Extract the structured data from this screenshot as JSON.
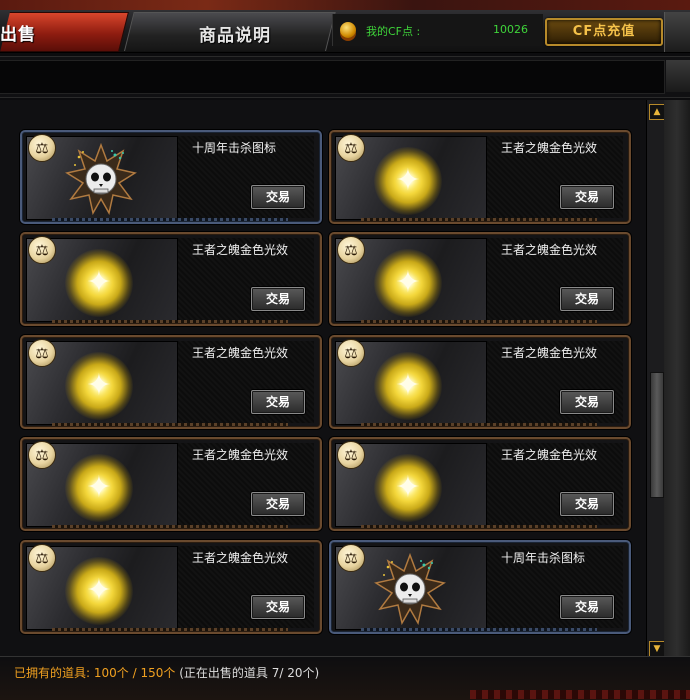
{
  "tabs": {
    "sell_label": "出售",
    "description_label": "商品说明"
  },
  "account": {
    "cf_points_label": "我的CF点 :",
    "cf_points_value": "10026",
    "recharge_label": "CF点充值"
  },
  "items": [
    {
      "badge": "⚖",
      "name": "十周年击杀图标",
      "icon": "skull-emblem-icon",
      "frame": "blue",
      "action": "交易"
    },
    {
      "badge": "⚖",
      "name": "王者之魄金色光效",
      "icon": "gold-glow-effect-icon",
      "frame": "bronze",
      "action": "交易"
    },
    {
      "badge": "⚖",
      "name": "王者之魄金色光效",
      "icon": "gold-glow-effect-icon",
      "frame": "bronze",
      "action": "交易"
    },
    {
      "badge": "⚖",
      "name": "王者之魄金色光效",
      "icon": "gold-glow-effect-icon",
      "frame": "bronze",
      "action": "交易"
    },
    {
      "badge": "⚖",
      "name": "王者之魄金色光效",
      "icon": "gold-glow-effect-icon",
      "frame": "bronze",
      "action": "交易"
    },
    {
      "badge": "⚖",
      "name": "王者之魄金色光效",
      "icon": "gold-glow-effect-icon",
      "frame": "bronze",
      "action": "交易"
    },
    {
      "badge": "⚖",
      "name": "王者之魄金色光效",
      "icon": "gold-glow-effect-icon",
      "frame": "bronze",
      "action": "交易"
    },
    {
      "badge": "⚖",
      "name": "王者之魄金色光效",
      "icon": "gold-glow-effect-icon",
      "frame": "bronze",
      "action": "交易"
    },
    {
      "badge": "⚖",
      "name": "王者之魄金色光效",
      "icon": "gold-glow-effect-icon",
      "frame": "bronze",
      "action": "交易"
    },
    {
      "badge": "⚖",
      "name": "十周年击杀图标",
      "icon": "skull-emblem-icon",
      "frame": "blue",
      "action": "交易"
    }
  ],
  "scrollbar": {
    "up_glyph": "▲",
    "down_glyph": "▼"
  },
  "footer": {
    "owned_label": "已拥有的道具:",
    "owned_value": "100个 / 150个",
    "selling_label": "(正在出售的道具",
    "selling_value": "7/ 20个)"
  },
  "colors": {
    "accent_orange": "#f0a020",
    "points_green": "#3fd43a",
    "gold": "#b78a2a",
    "bronze_frame": "#6a4a2e",
    "blue_frame": "#4a5a7a"
  }
}
